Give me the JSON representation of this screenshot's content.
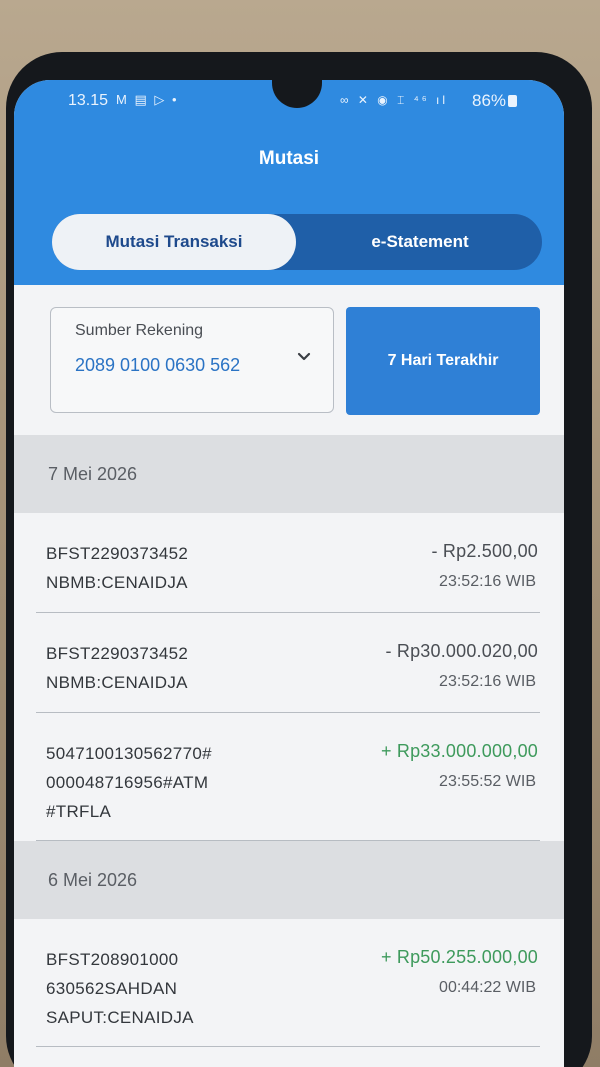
{
  "statusbar": {
    "time": "13.15",
    "left_icons": "M ▤ ▷ •",
    "right_icons": "∞ ✕ ◉ ⌶ ⁴⁶ ıl",
    "battery": "86%"
  },
  "header": {
    "title": "Mutasi",
    "tabs": [
      {
        "label": "Mutasi Transaksi",
        "active": true
      },
      {
        "label": "e-Statement",
        "active": false
      }
    ]
  },
  "filter": {
    "source_label": "Sumber Rekening",
    "source_value": "2089 0100 0630 562",
    "period_label": "7 Hari Terakhir"
  },
  "groups": [
    {
      "date": "7 Mei 2026",
      "transactions": [
        {
          "desc_lines": [
            "BFST2290373452",
            "NBMB:CENAIDJA"
          ],
          "amount": "- Rp2.500,00",
          "type": "debit",
          "time": "23:52:16 WIB"
        },
        {
          "desc_lines": [
            "BFST2290373452",
            "NBMB:CENAIDJA"
          ],
          "amount": "- Rp30.000.020,00",
          "type": "debit",
          "time": "23:52:16 WIB"
        },
        {
          "desc_lines": [
            "5047100130562770#",
            "000048716956#ATM",
            "#TRFLA"
          ],
          "amount": "+ Rp33.000.000,00",
          "type": "credit",
          "time": "23:55:52 WIB"
        }
      ]
    },
    {
      "date": "6 Mei 2026",
      "transactions": [
        {
          "desc_lines": [
            "BFST208901000",
            "630562SAHDAN",
            "SAPUT:CENAIDJA"
          ],
          "amount": "+ Rp50.255.000,00",
          "type": "credit",
          "time": "00:44:22 WIB"
        }
      ]
    }
  ],
  "colors": {
    "header_blue": "#2f8ae0",
    "button_blue": "#2f80d6",
    "tab_track": "#1f5fa8",
    "credit_green": "#3e9a5c",
    "debit_gray": "#4a4e54"
  }
}
